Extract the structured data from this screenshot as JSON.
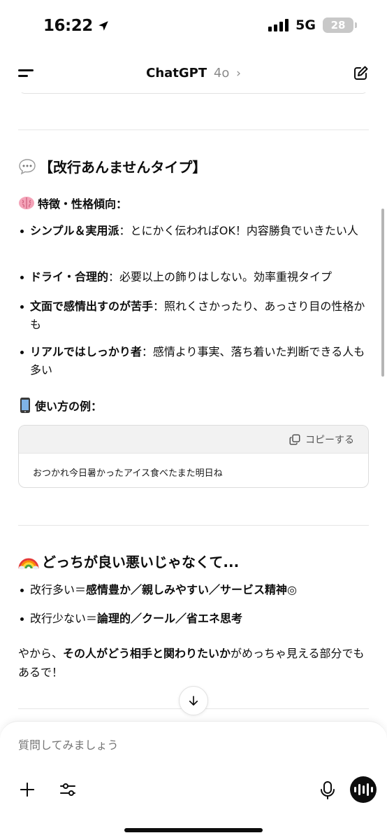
{
  "status_bar": {
    "time": "16:22",
    "network": "5G",
    "battery": "28"
  },
  "header": {
    "title": "ChatGPT",
    "model": "4o"
  },
  "message": {
    "section1": {
      "heading": "【改行あんませんタイプ】",
      "traits_heading": "特徴・性格傾向：",
      "traits": [
        {
          "bold": "シンプル＆実用派",
          "text": "：とにかく伝わればOK！内容勝負でいきたい人"
        },
        {
          "bold": "ドライ・合理的",
          "text": "：必要以上の飾りはしない。効率重視タイプ"
        },
        {
          "bold": "文面で感情出すのが苦手",
          "text": "：照れくさかったり、あっさり目の性格かも"
        },
        {
          "bold": "リアルではしっかり者",
          "text": "：感情より事実、落ち着いた判断できる人も多い"
        }
      ],
      "example_heading": "使い方の例：",
      "copy_label": "コピーする",
      "example_text": "おつかれ今日暑かったアイス食べたまた明日ね"
    },
    "section2": {
      "heading": "どっちが良い悪いじゃなくて...",
      "items": [
        {
          "prefix": "改行多い＝",
          "bold": "感情豊か／親しみやすい／サービス精神◎"
        },
        {
          "prefix": "改行少ない＝",
          "bold": "論理的／クール／省エネ思考"
        }
      ],
      "closing_prefix": "やから、",
      "closing_bold": "その人がどう相手と関わりたいか",
      "closing_suffix": "がめっちゃ見える部分でもあるで！"
    }
  },
  "composer": {
    "placeholder": "質問してみましょう"
  },
  "icons": {
    "location": "location-arrow-icon",
    "menu": "menu-icon",
    "edit": "compose-icon",
    "speech": "speech-bubble-icon",
    "brain": "brain-icon",
    "phone": "mobile-phone-icon",
    "rainbow": "rainbow-icon",
    "copy": "copy-icon",
    "arrow_down": "arrow-down-icon",
    "plus": "plus-icon",
    "tune": "sliders-icon",
    "mic": "microphone-icon",
    "voice": "voice-mode-icon"
  }
}
